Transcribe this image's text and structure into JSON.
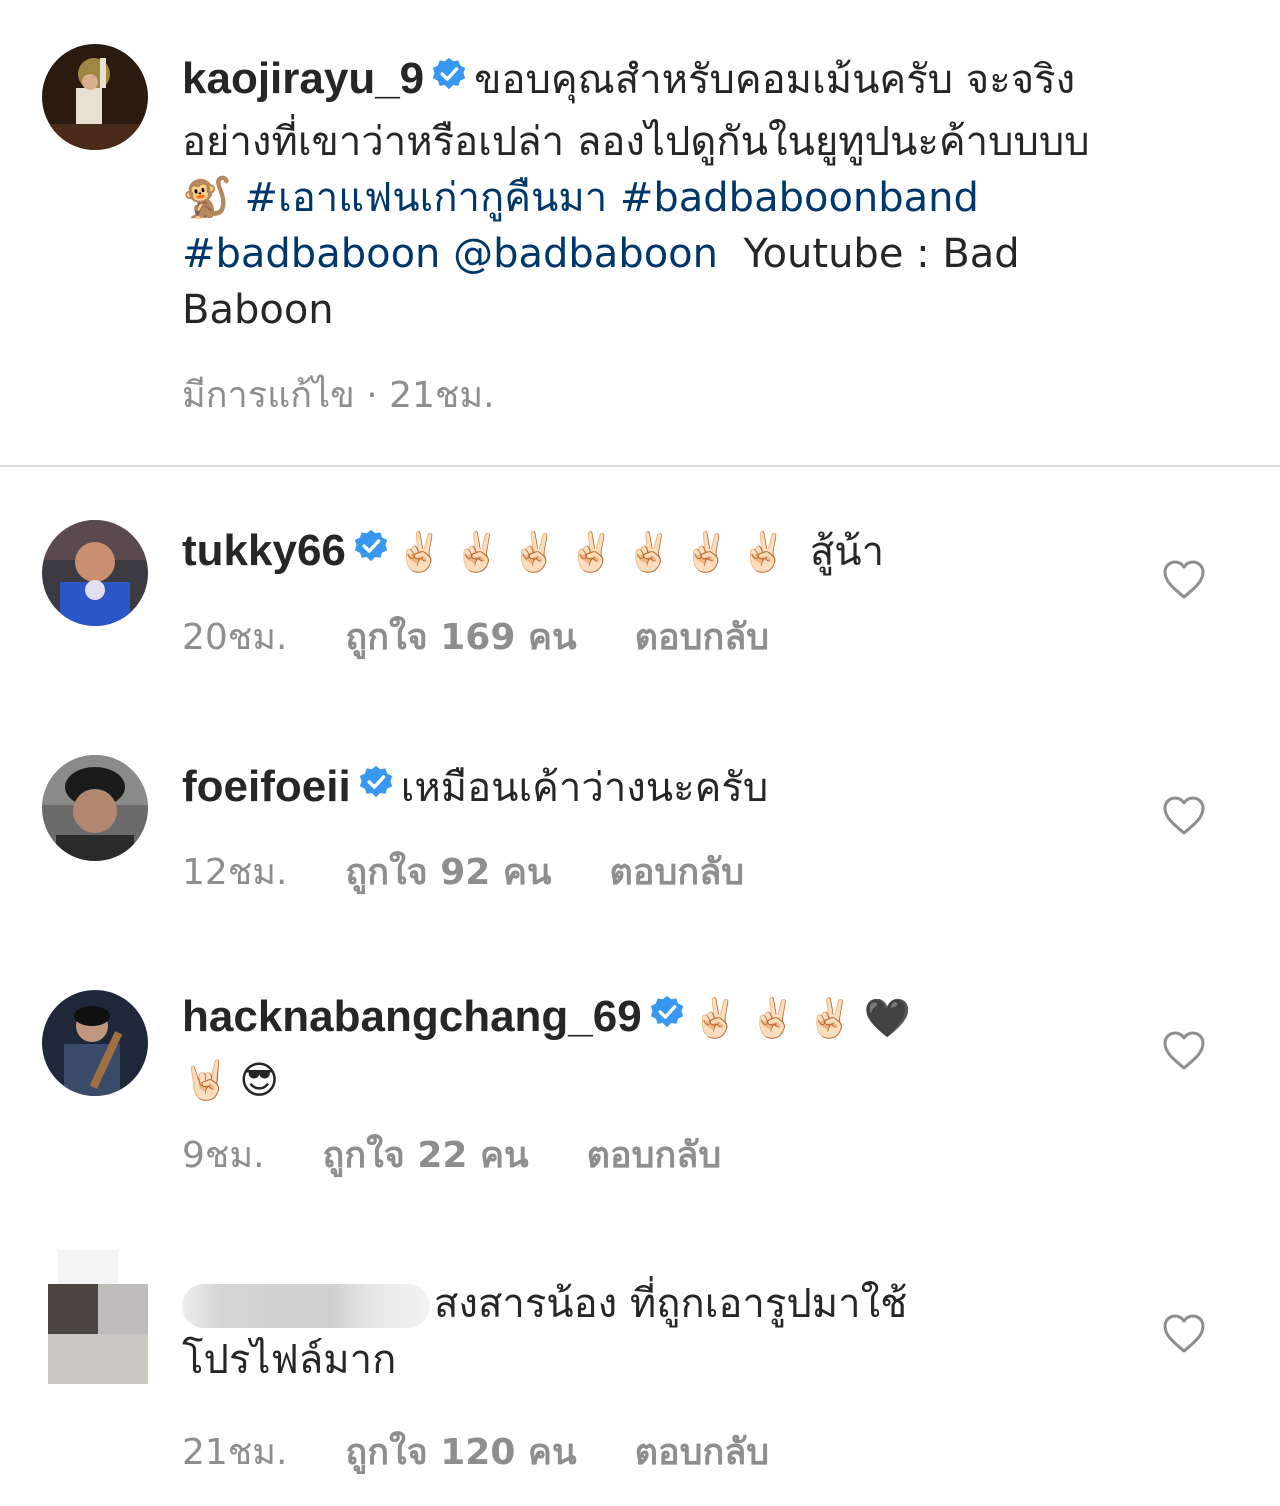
{
  "caption": {
    "username": "kaojirayu_9",
    "text_line1": "ขอบคุณสำหรับคอมเม้นครับ จะจริง",
    "text_line2": "อย่างที่เขาว่าหรือเปล่า ลองไปดูกันในยูทูปนะค้าบบบบ",
    "monkey_emoji": "🐒",
    "hashtag1": "#เอาแฟนเก่ากูคืนมา",
    "hashtag2": "#badbaboonband",
    "hashtag3": "#badbaboon",
    "mention": "@badbaboon",
    "youtube_text": "Youtube : Bad",
    "youtube_text2": "Baboon",
    "meta": "มีการแก้ไข · 21ชม."
  },
  "comments": [
    {
      "username": "tukky66",
      "text": "✌🏻✌🏻✌🏻✌🏻✌🏻✌🏻✌🏻",
      "text2": "สู้น้า",
      "time": "20ชม.",
      "likes": "ถูกใจ 169 คน",
      "reply": "ตอบกลับ"
    },
    {
      "username": "foeifoeii",
      "text": "เหมือนเค้าว่างนะครับ",
      "time": "12ชม.",
      "likes": "ถูกใจ 92 คน",
      "reply": "ตอบกลับ"
    },
    {
      "username": "hacknabangchang_69",
      "text": "✌🏻✌🏻✌🏻🖤",
      "text2": "🤘🏻😎",
      "time": "9ชม.",
      "likes": "ถูกใจ 22 คน",
      "reply": "ตอบกลับ"
    },
    {
      "text": "สงสารน้อง ที่ถูกเอารูปมาใช้",
      "text2": "โปรไฟล์มาก",
      "time": "21ชม.",
      "likes": "ถูกใจ 120 คน",
      "reply": "ตอบกลับ"
    }
  ],
  "icons": {
    "verified": "verified-badge-icon",
    "heart": "heart-outline-icon"
  },
  "colors": {
    "link": "#00376b",
    "verified": "#3897f0",
    "meta": "#8e8e8e",
    "divider": "#dbdbdb"
  }
}
